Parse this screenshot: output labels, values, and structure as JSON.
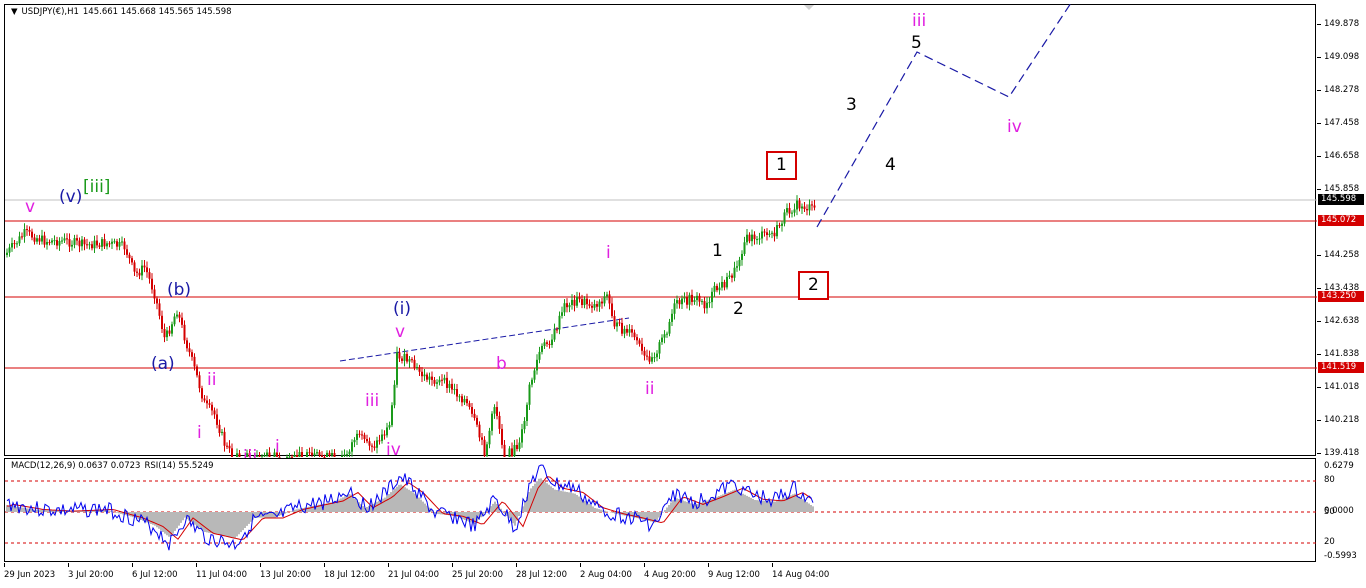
{
  "header": {
    "menu_icon": "triangle-down-icon",
    "symbol": "USDJPY(€),H1",
    "ohlc": "145.661 145.668 145.565 145.598"
  },
  "indicator_header": {
    "macd": "MACD(12,26,9) 0.0637 0.0723",
    "rsi": "RSI(14) 55.5249"
  },
  "price_scale": {
    "ticks": [
      "149.878",
      "149.098",
      "148.278",
      "147.458",
      "146.658",
      "145.858",
      "144.258",
      "143.438",
      "142.638",
      "141.838",
      "141.018",
      "140.218",
      "139.418"
    ],
    "current_price": "145.598",
    "levels": [
      "145.072",
      "143.250",
      "141.519"
    ]
  },
  "indicator_scale": {
    "ticks": [
      "0.6279",
      "80",
      "0.0000",
      "50",
      "20",
      "-0.5993"
    ]
  },
  "time_axis": {
    "labels": [
      "29 Jun 2023",
      "3 Jul 20:00",
      "6 Jul 12:00",
      "11 Jul 04:00",
      "13 Jul 20:00",
      "18 Jul 12:00",
      "21 Jul 04:00",
      "25 Jul 20:00",
      "28 Jul 12:00",
      "2 Aug 04:00",
      "4 Aug 20:00",
      "9 Aug 12:00",
      "14 Aug 04:00"
    ]
  },
  "wave_labels": {
    "v_top": "v",
    "v_paren": "(v)",
    "iii_bracket": "[iii]",
    "b_paren": "(b)",
    "a_paren": "(a)",
    "ii_left": "ii",
    "i_left": "i",
    "iii_bottom_partial": "iii",
    "i_bottom_partial": "i",
    "i_paren": "(i)",
    "v_mid": "v",
    "iii_mid": "iii",
    "iv_mid": "iv",
    "b_mid": "b",
    "i_right": "i",
    "ii_right": "ii",
    "one": "1",
    "two": "2",
    "boxed_one": "1",
    "boxed_two": "2",
    "three": "3",
    "four": "4",
    "five": "5",
    "iii_proj": "iii",
    "iv_proj": "iv"
  },
  "colors": {
    "level_line": "#d40000",
    "projection": "#1a1aa6",
    "magenta": "#e020e0",
    "blue": "#1a1aa6",
    "green": "#1a9a1a",
    "candle_up": "#1a9a1a",
    "candle_down": "#d40000",
    "macd_hist": "#c0c0c0",
    "rsi_line": "#0000ee",
    "signal_line": "#d40000",
    "price_tag": "#000000"
  }
}
